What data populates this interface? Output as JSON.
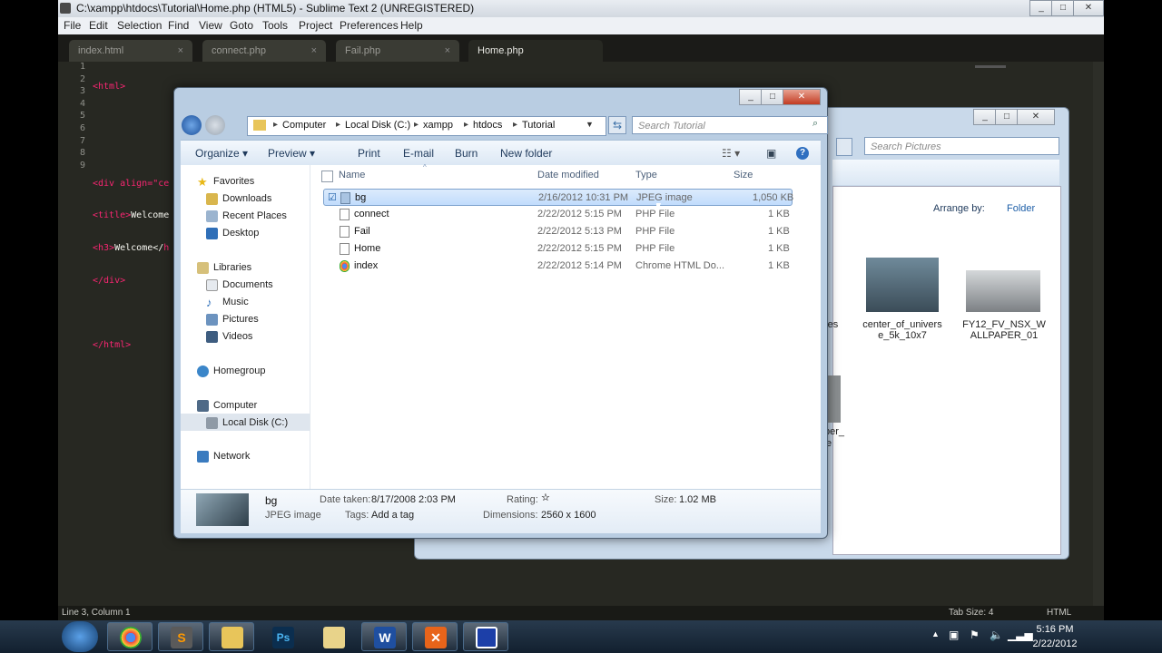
{
  "sublime": {
    "title": "C:\\xampp\\htdocs\\Tutorial\\Home.php (HTML5) - Sublime Text 2 (UNREGISTERED)",
    "menu": [
      "File",
      "Edit",
      "Selection",
      "Find",
      "View",
      "Goto",
      "Tools",
      "Project",
      "Preferences",
      "Help"
    ],
    "tabs": [
      {
        "label": "index.html",
        "close": "×"
      },
      {
        "label": "connect.php",
        "close": "×"
      },
      {
        "label": "Fail.php",
        "close": "×"
      },
      {
        "label": "Home.php",
        "close": "×"
      }
    ],
    "line_numbers": [
      "1",
      "2",
      "3",
      "4",
      "5",
      "6",
      "7",
      "8",
      "9"
    ],
    "code": {
      "l1": "<html>",
      "l4a": "<div align=\"ce",
      "l5a": "<title>",
      "l5b": "Welcome",
      "l6a": "<h3>",
      "l6b": "Welcome</",
      "l6c": "h",
      "l7": "</div>",
      "l9": "</html>"
    },
    "status_left": "Line 3, Column 1",
    "status_tab": "Tab Size: 4",
    "status_syntax": "HTML"
  },
  "explorer": {
    "breadcrumb": [
      "Computer",
      "Local Disk (C:)",
      "xampp",
      "htdocs",
      "Tutorial"
    ],
    "search_placeholder": "Search Tutorial",
    "commands": [
      "Organize",
      "Preview",
      "Print",
      "E-mail",
      "Burn",
      "New folder"
    ],
    "nav": {
      "favorites": "Favorites",
      "downloads": "Downloads",
      "recent": "Recent Places",
      "desktop": "Desktop",
      "libraries": "Libraries",
      "documents": "Documents",
      "music": "Music",
      "pictures": "Pictures",
      "videos": "Videos",
      "homegroup": "Homegroup",
      "computer": "Computer",
      "localdisk": "Local Disk (C:)",
      "network": "Network"
    },
    "columns": {
      "name": "Name",
      "date": "Date modified",
      "type": "Type",
      "size": "Size"
    },
    "files": [
      {
        "name": "bg",
        "date": "2/16/2012 10:31 PM",
        "type": "JPEG image",
        "size": "1,050 KB"
      },
      {
        "name": "connect",
        "date": "2/22/2012 5:15 PM",
        "type": "PHP File",
        "size": "1 KB"
      },
      {
        "name": "Fail",
        "date": "2/22/2012 5:13 PM",
        "type": "PHP File",
        "size": "1 KB"
      },
      {
        "name": "Home",
        "date": "2/22/2012 5:15 PM",
        "type": "PHP File",
        "size": "1 KB"
      },
      {
        "name": "index",
        "date": "2/22/2012 5:14 PM",
        "type": "Chrome HTML Do...",
        "size": "1 KB"
      }
    ],
    "details": {
      "name": "bg",
      "kind": "JPEG image",
      "date_taken_label": "Date taken:",
      "date_taken": "8/17/2008 2:03 PM",
      "tags_label": "Tags:",
      "tags": "Add a tag",
      "rating_label": "Rating:",
      "dimensions_label": "Dimensions:",
      "dimensions": "2560 x 1600",
      "size_label": "Size:",
      "size": "1.02 MB"
    }
  },
  "pictures_window": {
    "search_placeholder": "Search Pictures",
    "arrange_label": "Arrange by:",
    "arrange_value": "Folder",
    "thumb1": "center_of_univers e_5k_10x7",
    "thumb2": "FY12_FV_NSX_W ALLPAPER_01",
    "partial1": "res",
    "partial2": "per_",
    "partial3": "e"
  },
  "taskbar": {
    "time": "5:16 PM",
    "date": "2/22/2012",
    "apps": [
      "chrome",
      "sublime",
      "explorer",
      "photoshop",
      "snipping",
      "word",
      "xampp",
      "app"
    ]
  }
}
